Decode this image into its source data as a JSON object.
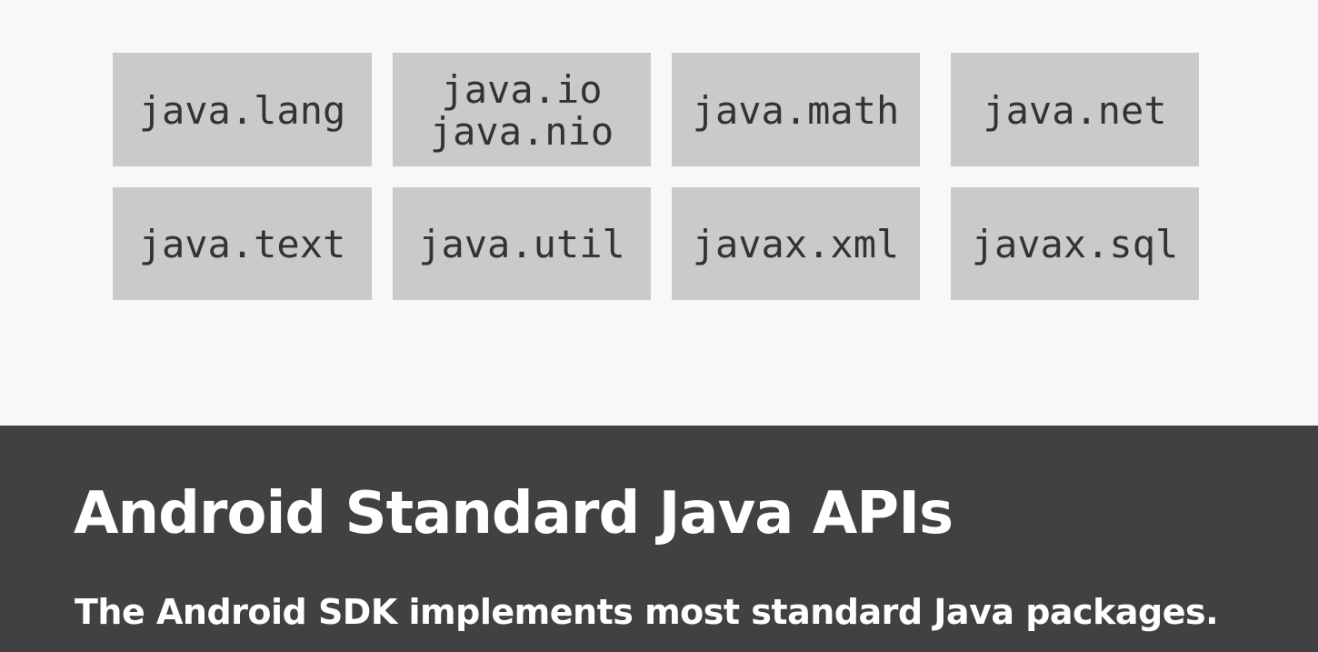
{
  "packages": {
    "row1": [
      {
        "lines": [
          "java.lang"
        ]
      },
      {
        "lines": [
          "java.io",
          "java.nio"
        ]
      },
      {
        "lines": [
          "java.math"
        ]
      },
      {
        "lines": [
          "java.net"
        ]
      }
    ],
    "row2": [
      {
        "lines": [
          "java.text"
        ]
      },
      {
        "lines": [
          "java.util"
        ]
      },
      {
        "lines": [
          "javax.xml"
        ]
      },
      {
        "lines": [
          "javax.sql"
        ]
      }
    ]
  },
  "caption": {
    "title": "Android Standard Java APIs",
    "subtitle": "The Android SDK implements most standard Java packages."
  },
  "colors": {
    "page_background": "#f8f8f8",
    "tile_background": "#cacaca",
    "tile_text": "#333333",
    "caption_bar": "#414144",
    "caption_text": "#ffffff"
  }
}
